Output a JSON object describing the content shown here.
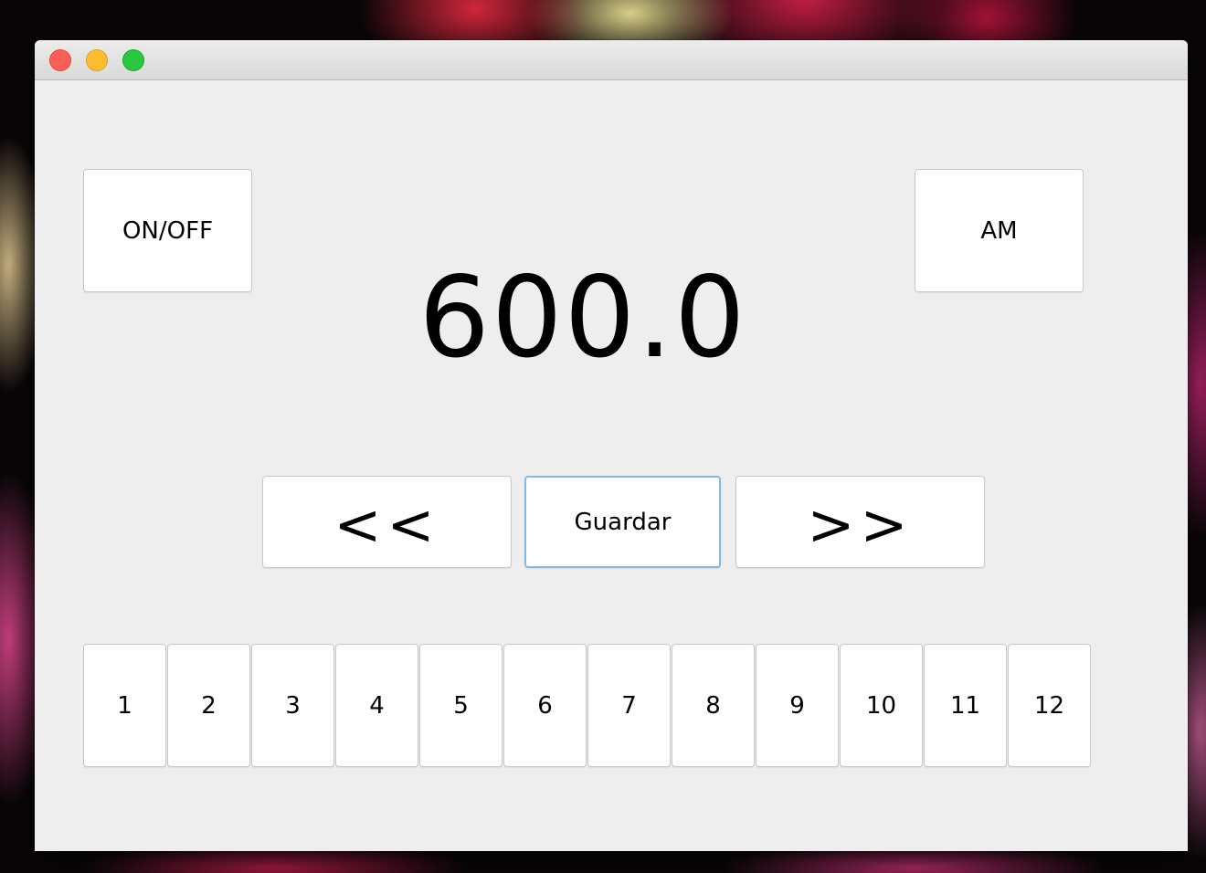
{
  "window": {
    "controls": [
      "close",
      "minimize",
      "zoom"
    ]
  },
  "radio": {
    "power_label": "ON/OFF",
    "band_label": "AM",
    "frequency": "600.0",
    "prev_label": "<<",
    "save_label": "Guardar",
    "next_label": ">>",
    "presets": [
      "1",
      "2",
      "3",
      "4",
      "5",
      "6",
      "7",
      "8",
      "9",
      "10",
      "11",
      "12"
    ]
  },
  "colors": {
    "window_bg": "#eeeeee",
    "focus_ring": "#85b7e8",
    "close": "#fd5f57",
    "minimize": "#febc2e",
    "zoom": "#28c840"
  }
}
